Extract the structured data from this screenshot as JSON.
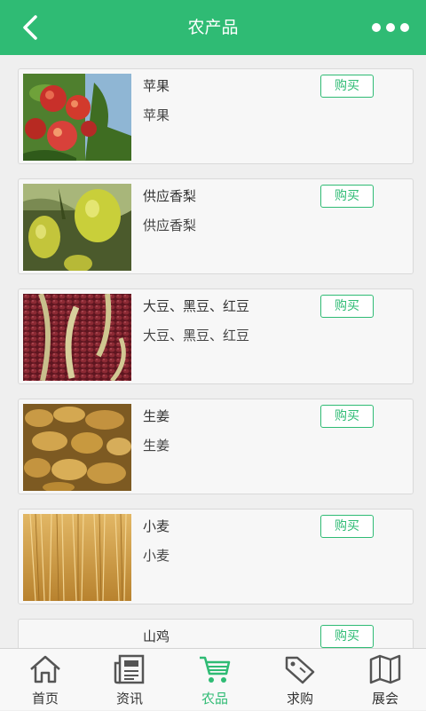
{
  "header": {
    "title": "农产品",
    "back_icon": "chevron-left-icon",
    "more_icon": "more-dots-icon"
  },
  "products": [
    {
      "name": "苹果",
      "desc": "苹果",
      "buy_label": "购买",
      "image": "apples-photo"
    },
    {
      "name": "供应香梨",
      "desc": "供应香梨",
      "buy_label": "购买",
      "image": "pears-photo"
    },
    {
      "name": "大豆、黑豆、红豆",
      "desc": "大豆、黑豆、红豆",
      "buy_label": "购买",
      "image": "beans-photo"
    },
    {
      "name": "生姜",
      "desc": "生姜",
      "buy_label": "购买",
      "image": "ginger-photo"
    },
    {
      "name": "小麦",
      "desc": "小麦",
      "buy_label": "购买",
      "image": "wheat-photo"
    },
    {
      "name": "山鸡",
      "buy_label": "购买"
    }
  ],
  "tabs": [
    {
      "label": "首页",
      "icon": "home-icon"
    },
    {
      "label": "资讯",
      "icon": "news-icon"
    },
    {
      "label": "农品",
      "icon": "cart-icon",
      "active": true
    },
    {
      "label": "求购",
      "icon": "tag-icon"
    },
    {
      "label": "展会",
      "icon": "map-icon"
    }
  ],
  "colors": {
    "accent": "#2fbb74",
    "background": "#efefef"
  }
}
